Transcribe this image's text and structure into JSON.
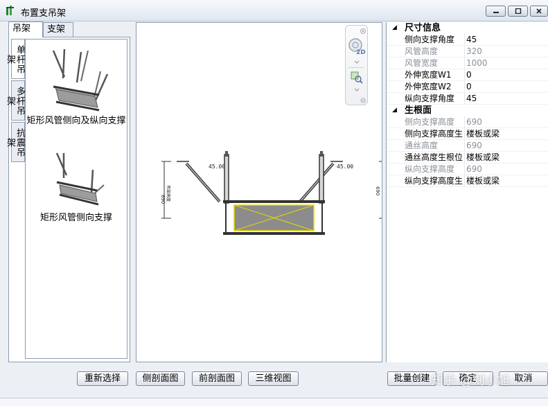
{
  "window": {
    "title": "布置支吊架"
  },
  "tabs": [
    {
      "label": "吊架"
    },
    {
      "label": "支架"
    }
  ],
  "vtabs": [
    {
      "label": "单杆吊架"
    },
    {
      "label": "多杆吊架"
    },
    {
      "label": "抗震吊架"
    }
  ],
  "gallery": [
    {
      "caption": "矩形风管侧向及纵向支撑"
    },
    {
      "caption": "矩形风管侧向支撑"
    }
  ],
  "preview": {
    "angle_left": "45.00",
    "angle_right": "45.00",
    "dim_left": "690",
    "dim_left_note": "吊架高度",
    "dim_right": "690",
    "nav_2d": "2D"
  },
  "properties": {
    "categories": [
      {
        "title": "尺寸信息",
        "rows": [
          {
            "key": "侧向支撑角度",
            "value": "45",
            "disabled": false
          },
          {
            "key": "风管高度",
            "value": "320",
            "disabled": true
          },
          {
            "key": "风管宽度",
            "value": "1000",
            "disabled": true
          },
          {
            "key": "外伸宽度W1",
            "value": "0",
            "disabled": false
          },
          {
            "key": "外伸宽度W2",
            "value": "0",
            "disabled": false
          },
          {
            "key": "纵向支撑角度",
            "value": "45",
            "disabled": false
          }
        ]
      },
      {
        "title": "生根面",
        "rows": [
          {
            "key": "侧向支撑高度",
            "value": "690",
            "disabled": true
          },
          {
            "key": "侧向支撑高度生",
            "value": "楼板或梁",
            "disabled": false
          },
          {
            "key": "通丝高度",
            "value": "690",
            "disabled": true
          },
          {
            "key": "通丝高度生根位",
            "value": "楼板或梁",
            "disabled": false
          },
          {
            "key": "纵向支撑高度",
            "value": "690",
            "disabled": true
          },
          {
            "key": "纵向支撑高度生",
            "value": "楼板或梁",
            "disabled": false
          }
        ]
      }
    ]
  },
  "buttons": {
    "reselect": "重新选择",
    "side_section": "侧剖面图",
    "front_section": "前剖面图",
    "view_3d": "三维视图",
    "batch_create": "批量创建",
    "ok": "确定",
    "cancel": "取消"
  },
  "watermark": "知乎 @刘小旭",
  "colors": {
    "duct_fill": "#8c8c8c",
    "duct_cross": "#e6d800",
    "accent": "#3a6ea5"
  }
}
